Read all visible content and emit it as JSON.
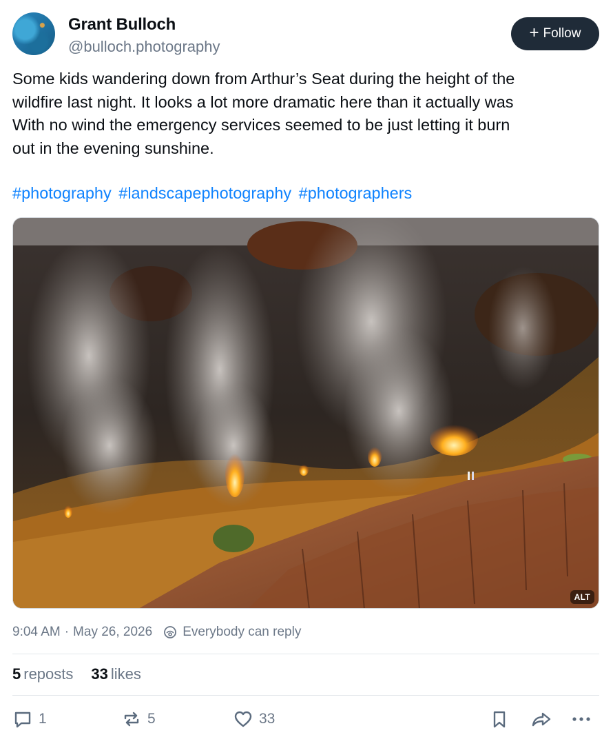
{
  "author": {
    "name": "Grant Bulloch",
    "handle": "@bulloch.photography"
  },
  "follow_button": {
    "label": "Follow",
    "icon": "plus-icon"
  },
  "post": {
    "text_lines": [
      "Some kids wandering down from Arthur’s Seat during the height of the",
      "wildfire last night. It looks a lot more dramatic here than it actually was",
      "With no wind the emergency services seemed to be just letting it burn",
      "out  in the evening sunshine."
    ],
    "hashtags": [
      "#photography",
      "#landscapephotography",
      "#photographers"
    ],
    "image_alt_badge": "ALT"
  },
  "meta": {
    "time": "9:04 AM",
    "separator": "·",
    "date": "May 26, 2026",
    "reply_setting": "Everybody can reply"
  },
  "stats": {
    "reposts_count": "5",
    "reposts_label": "reposts",
    "likes_count": "33",
    "likes_label": "likes"
  },
  "actions": {
    "reply_count": "1",
    "repost_count": "5",
    "like_count": "33"
  },
  "colors": {
    "link": "#1083fe",
    "follow_bg": "#1f2b38",
    "muted": "#6b7787"
  }
}
